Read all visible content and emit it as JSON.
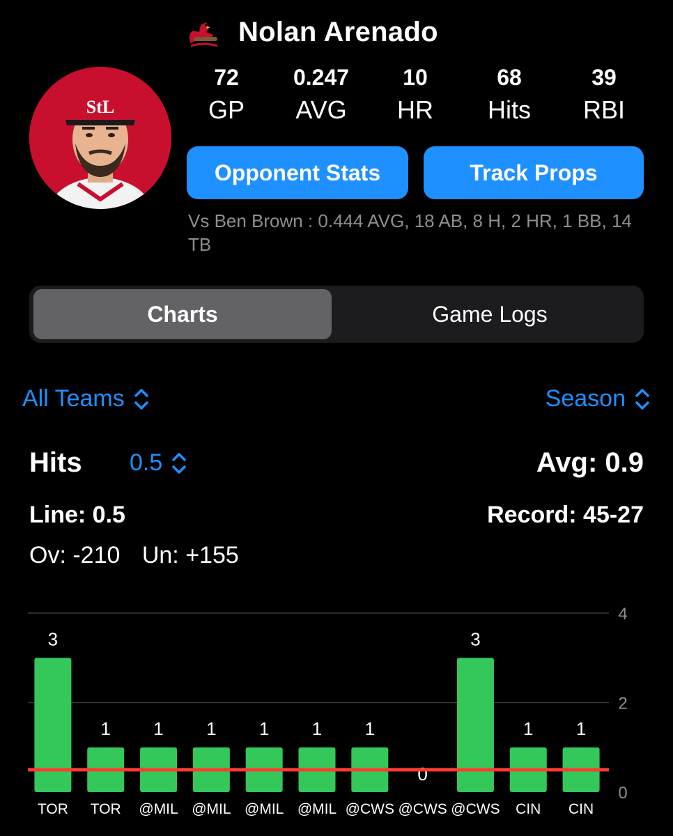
{
  "player": {
    "name": "Nolan Arenado",
    "team_logo_icon": "cardinals-logo-icon",
    "avatar_icon": "player-headshot"
  },
  "stats": [
    {
      "value": "72",
      "label": "GP"
    },
    {
      "value": "0.247",
      "label": "AVG"
    },
    {
      "value": "10",
      "label": "HR"
    },
    {
      "value": "68",
      "label": "Hits"
    },
    {
      "value": "39",
      "label": "RBI"
    }
  ],
  "buttons": {
    "opponent_stats": "Opponent Stats",
    "track_props": "Track Props"
  },
  "vs_line": "Vs Ben Brown : 0.444 AVG, 18 AB, 8 H, 2 HR, 1 BB, 14 TB",
  "tabs": {
    "charts": "Charts",
    "game_logs": "Game Logs",
    "selected": "Charts"
  },
  "filters": {
    "teams": "All Teams",
    "period": "Season"
  },
  "stat": {
    "name": "Hits",
    "line_select": "0.5",
    "avg": "Avg: 0.9",
    "line": "Line: 0.5",
    "record": "Record: 45-27",
    "over": "Ov: -210",
    "under": "Un: +155"
  },
  "colors": {
    "accent": "#1e90ff",
    "bar": "#34c759",
    "line": "#ff3b30",
    "background": "#000000"
  },
  "chart_data": {
    "type": "bar",
    "categories": [
      "TOR",
      "TOR",
      "@MIL",
      "@MIL",
      "@MIL",
      "@MIL",
      "@CWS",
      "@CWS",
      "@CWS",
      "CIN",
      "CIN"
    ],
    "values": [
      3,
      1,
      1,
      1,
      1,
      1,
      1,
      0,
      3,
      1,
      1
    ],
    "ylim": [
      0,
      4
    ],
    "yticks": [
      0,
      2,
      4
    ],
    "reference_line": 0.5,
    "grid": true
  }
}
